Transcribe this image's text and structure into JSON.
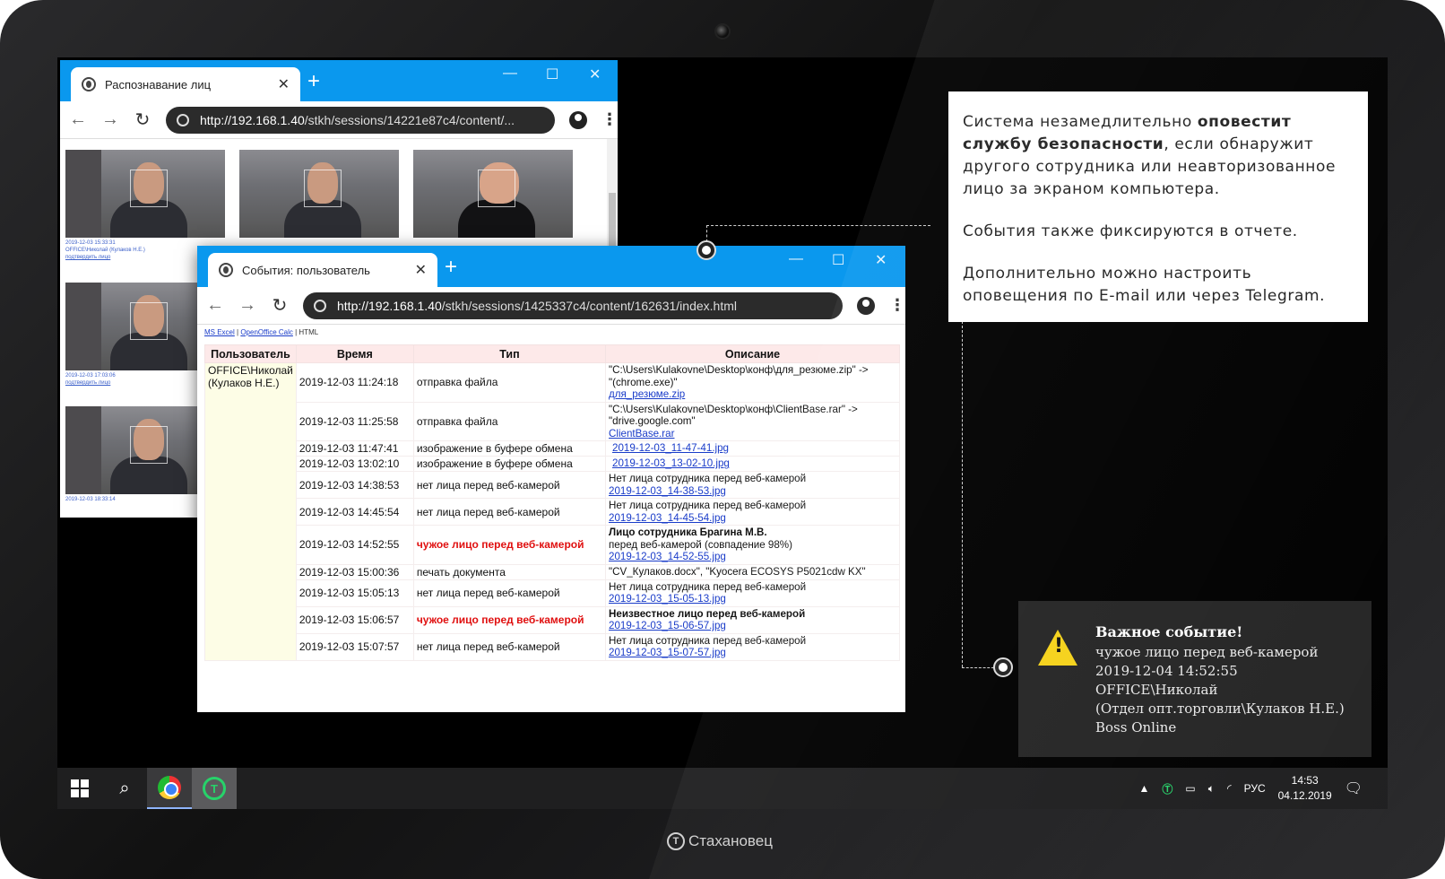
{
  "brand": "Стахановец",
  "window1": {
    "tab_title": "Распознавание лиц",
    "url_host": "http://192.168.1.40",
    "url_path": "/stkh/sessions/14221e87c4/content/..."
  },
  "window2": {
    "tab_title": "События: пользователь",
    "url_host": "http://192.168.1.40",
    "url_path": "/stkh/sessions/1425337c4/content/162631/index.html",
    "links": {
      "excel": "MS Excel",
      "calc": "OpenOffice Calc",
      "html": "HTML"
    },
    "headers": [
      "Пользователь",
      "Время",
      "Тип",
      "Описание"
    ],
    "user": "OFFICE\\Николай (Кулаков Н.Е.)",
    "rows": [
      {
        "time": "2019-12-03 11:24:18",
        "type": "отправка файла",
        "d1": "\"C:\\Users\\Kulakovne\\Desktop\\конф\\для_резюме.zip\" ->",
        "d2": "\"(chrome.exe)\"",
        "link": "для_резюме.zip"
      },
      {
        "time": "2019-12-03 11:25:58",
        "type": "отправка файла",
        "d1": "\"C:\\Users\\Kulakovne\\Desktop\\конф\\ClientBase.rar\" ->",
        "d2": "\"drive.google.com\"",
        "link": "ClientBase.rar"
      },
      {
        "time": "2019-12-03 11:47:41",
        "type": "изображение в буфере обмена",
        "link": "2019-12-03_11-47-41.jpg"
      },
      {
        "time": "2019-12-03 13:02:10",
        "type": "изображение в буфере обмена",
        "link": "2019-12-03_13-02-10.jpg"
      },
      {
        "time": "2019-12-03 14:38:53",
        "type": "нет лица перед веб-камерой",
        "d1": "Нет лица сотрудника перед веб-камерой",
        "link": "2019-12-03_14-38-53.jpg"
      },
      {
        "time": "2019-12-03 14:45:54",
        "type": "нет лица перед веб-камерой",
        "d1": "Нет лица сотрудника перед веб-камерой",
        "link": "2019-12-03_14-45-54.jpg"
      },
      {
        "time": "2019-12-03 14:52:55",
        "type": "чужое лицо перед веб-камерой",
        "d1": "Лицо сотрудника Брагина М.В.",
        "d2": "перед веб-камерой (совпадение 98%)",
        "link": "2019-12-03_14-52-55.jpg"
      },
      {
        "time": "2019-12-03 15:00:36",
        "type": "печать документа",
        "d1": "\"CV_Кулаков.docx\", \"Kyocera ECOSYS P5021cdw KX\""
      },
      {
        "time": "2019-12-03 15:05:13",
        "type": "нет лица перед веб-камерой",
        "d1": "Нет лица сотрудника перед веб-камерой",
        "link": "2019-12-03_15-05-13.jpg"
      },
      {
        "time": "2019-12-03 15:06:57",
        "type": "чужое лицо перед веб-камерой",
        "d1": "Неизвестное лицо перед веб-камерой",
        "link": "2019-12-03_15-06-57.jpg"
      },
      {
        "time": "2019-12-03 15:07:57",
        "type": "нет лица перед веб-камерой",
        "d1": "Нет лица сотрудника перед веб-камерой",
        "link": "2019-12-03_15-07-57.jpg"
      }
    ]
  },
  "info": {
    "p1_a": "Система незамедлительно ",
    "p1_b": "оповестит службу безопасности",
    "p1_c": ", если обнаружит другого сотрудника или неавторизованное лицо за экраном компьютера.",
    "p2": "События также фиксируются в отчете.",
    "p3": "Дополнительно можно настроить оповещения по E-mail или через Telegram."
  },
  "notification": {
    "title": "Важное событие!",
    "line1": "чужое лицо перед веб-камерой",
    "line2": "2019-12-04 14:52:55",
    "line3": "OFFICE\\Николай",
    "line4": "(Отдел опт.торговли\\Кулаков Н.Е.)",
    "line5": "Boss Online"
  },
  "taskbar": {
    "lang": "РУС",
    "time": "14:53",
    "date": "04.12.2019",
    "notif_count": "1"
  },
  "colors": {
    "accent": "#0a98ee",
    "alert": "#e01010",
    "success": "#27d36a"
  }
}
